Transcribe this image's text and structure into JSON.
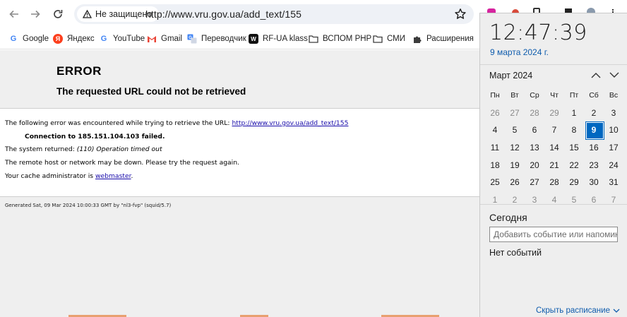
{
  "browser": {
    "security_label": "Не защищено",
    "url": "http://www.vru.gov.ua/add_text/155"
  },
  "bookmarks": [
    {
      "label": "Google",
      "icon": "google-icon"
    },
    {
      "label": "Яндекс",
      "icon": "yandex-icon"
    },
    {
      "label": "YouTube",
      "icon": "google-icon"
    },
    {
      "label": "Gmail",
      "icon": "gmail-icon"
    },
    {
      "label": "Переводчик",
      "icon": "translate-icon"
    },
    {
      "label": "RF-UA klass",
      "icon": "vk-icon"
    },
    {
      "label": "ВСПОМ РНР",
      "icon": "folder-icon"
    },
    {
      "label": "СМИ",
      "icon": "folder-icon"
    },
    {
      "label": "Расширения",
      "icon": "puzzle-icon"
    }
  ],
  "error": {
    "title": "ERROR",
    "subtitle": "The requested URL could not be retrieved",
    "line1_prefix": "The following error was encountered while trying to retrieve the URL: ",
    "line1_link": "http://www.vru.gov.ua/add_text/155",
    "line2": "Connection to 185.151.104.103 failed.",
    "line3_prefix": "The system returned: ",
    "line3_em": "(110) Operation timed out",
    "line4": "The remote host or network may be down. Please try the request again.",
    "line5_prefix": "Your cache administrator is ",
    "line5_link": "webmaster",
    "line5_suffix": ".",
    "generated": "Generated Sat, 09 Mar 2024 10:00:33 GMT by \"nl3-fvp\" (squid/5.7)"
  },
  "clock": {
    "time": "12:47:39",
    "date": "9 марта 2024 г.",
    "month": "Март 2024",
    "weekdays": [
      "Пн",
      "Вт",
      "Ср",
      "Чт",
      "Пт",
      "Сб",
      "Вс"
    ],
    "weeks": [
      [
        "26",
        "27",
        "28",
        "29",
        "1",
        "2",
        "3"
      ],
      [
        "4",
        "5",
        "6",
        "7",
        "8",
        "9",
        "10"
      ],
      [
        "11",
        "12",
        "13",
        "14",
        "15",
        "16",
        "17"
      ],
      [
        "18",
        "19",
        "20",
        "21",
        "22",
        "23",
        "24"
      ],
      [
        "25",
        "26",
        "27",
        "28",
        "29",
        "30",
        "31"
      ],
      [
        "1",
        "2",
        "3",
        "4",
        "5",
        "6",
        "7"
      ]
    ],
    "today_label": "Сегодня",
    "event_placeholder": "Добавить событие или напоминание",
    "no_events": "Нет событий",
    "hide_schedule": "Скрыть расписание"
  },
  "colors": {
    "accent": "#0067c0",
    "link": "#1a0dab",
    "flyout_link": "#0f5cad"
  }
}
